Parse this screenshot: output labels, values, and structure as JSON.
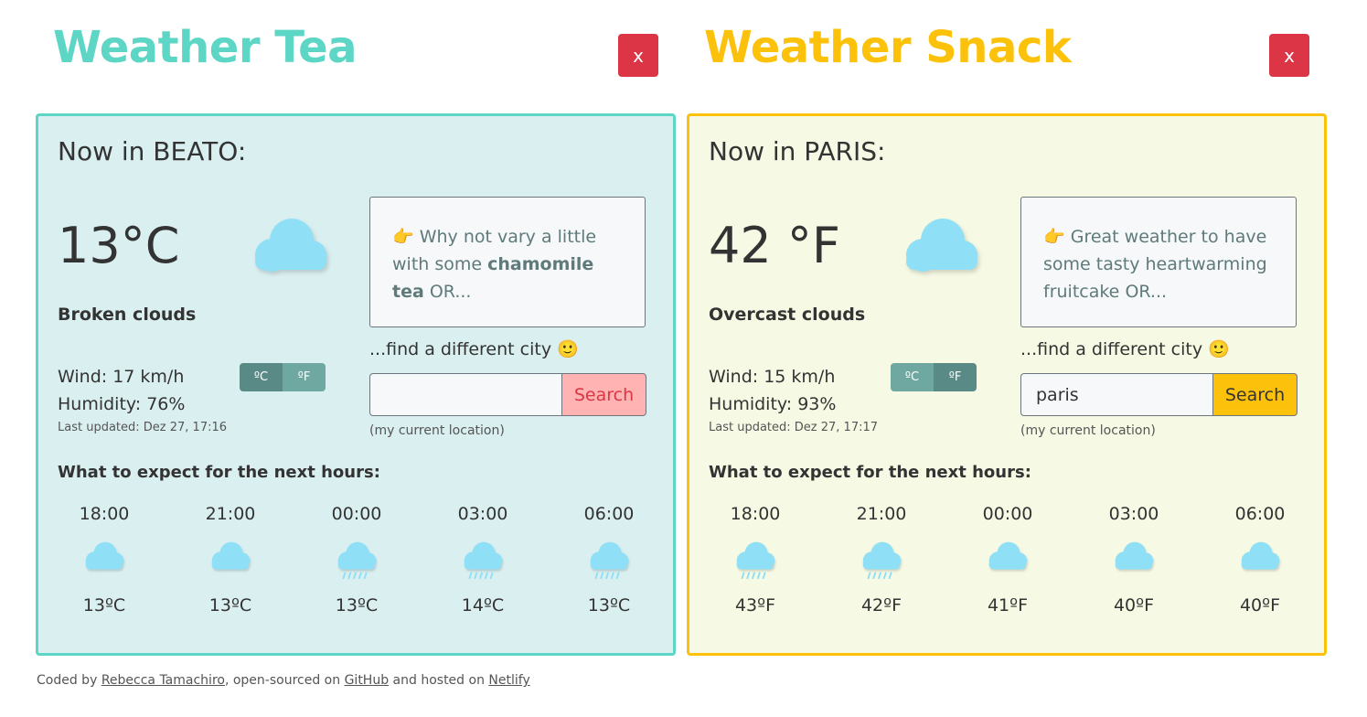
{
  "colors": {
    "tea_accent": "#5dd6c5",
    "tea_bg": "#daeff0",
    "snack_accent": "#fcc20b",
    "snack_bg": "#f6f9e3",
    "close": "#dc3545",
    "cloud": "#8fe0f7"
  },
  "tea": {
    "title": "Weather Tea",
    "close_label": "x",
    "city": "Now in BEATO:",
    "temperature": "13°C",
    "description": "Broken clouds",
    "wind": "Wind: 17 km/h",
    "humidity": "Humidity: 76%",
    "updated": "Last updated: Dez 27, 17:16",
    "unit_c": "ºC",
    "unit_f": "ºF",
    "suggestion_pre": "Why not vary a little with some",
    "suggestion_bold": "chamomile tea",
    "suggestion_post": "OR...",
    "find_city": "...find a different city",
    "search_value": "",
    "search_button": "Search",
    "current_location": "(my current location)",
    "forecast_title": "What to expect for the next hours:",
    "forecast": [
      {
        "time": "18:00",
        "icon": "cloud-icon",
        "temp": "13ºC"
      },
      {
        "time": "21:00",
        "icon": "cloud-icon",
        "temp": "13ºC"
      },
      {
        "time": "00:00",
        "icon": "rain-cloud-icon",
        "temp": "13ºC"
      },
      {
        "time": "03:00",
        "icon": "rain-cloud-icon",
        "temp": "14ºC"
      },
      {
        "time": "06:00",
        "icon": "rain-cloud-icon",
        "temp": "13ºC"
      }
    ]
  },
  "snack": {
    "title": "Weather Snack",
    "close_label": "x",
    "city": "Now in PARIS:",
    "temperature": "42 °F",
    "description": "Overcast clouds",
    "wind": "Wind: 15 km/h",
    "humidity": "Humidity: 93%",
    "updated": "Last updated: Dez 27, 17:17",
    "unit_c": "ºC",
    "unit_f": "ºF",
    "suggestion_pre": "Great weather to have some tasty heartwarming fruitcake",
    "suggestion_bold": "",
    "suggestion_post": "OR...",
    "find_city": "...find a different city",
    "search_value": "paris",
    "search_button": "Search",
    "current_location": "(my current location)",
    "forecast_title": "What to expect for the next hours:",
    "forecast": [
      {
        "time": "18:00",
        "icon": "rain-cloud-icon",
        "temp": "43ºF"
      },
      {
        "time": "21:00",
        "icon": "rain-cloud-icon",
        "temp": "42ºF"
      },
      {
        "time": "00:00",
        "icon": "cloud-icon",
        "temp": "41ºF"
      },
      {
        "time": "03:00",
        "icon": "cloud-icon",
        "temp": "40ºF"
      },
      {
        "time": "06:00",
        "icon": "cloud-icon",
        "temp": "40ºF"
      }
    ]
  },
  "footer": {
    "coded_by": "Coded by",
    "author": "Rebecca Tamachiro",
    "open_sourced": ", open-sourced on",
    "github": "GitHub",
    "hosted": "and hosted on",
    "netlify": "Netlify"
  }
}
